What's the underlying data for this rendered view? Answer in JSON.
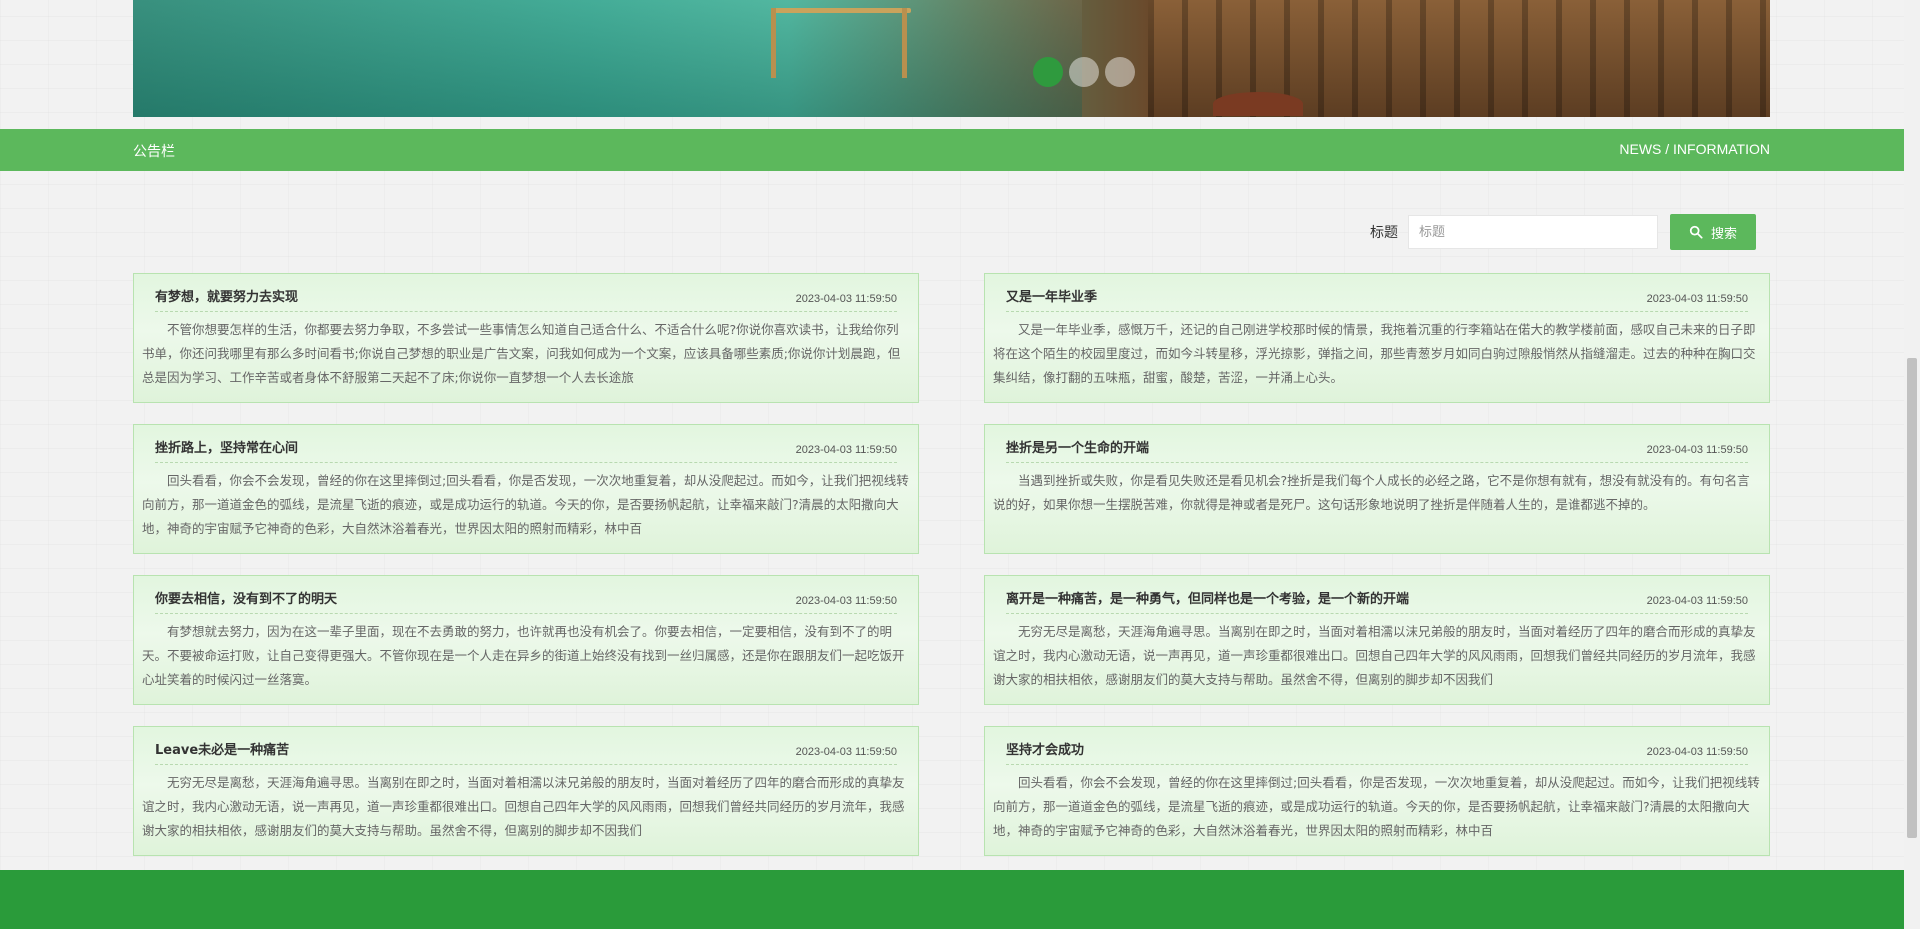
{
  "carousel": {
    "slide_count": 3,
    "active_index": 0,
    "active_color": "#2f9a3e"
  },
  "notice_bar": {
    "title": "公告栏",
    "subtitle": "NEWS / INFORMATION",
    "color": "#5cb85c"
  },
  "search": {
    "label": "标题",
    "placeholder": "标题",
    "value": "",
    "button_label": "搜索",
    "button_icon": "search-icon"
  },
  "notices": [
    {
      "title": "有梦想，就要努力去实现",
      "time": "2023-04-03 11:59:50",
      "content": "不管你想要怎样的生活，你都要去努力争取，不多尝试一些事情怎么知道自己适合什么、不适合什么呢?你说你喜欢读书，让我给你列书单，你还问我哪里有那么多时间看书;你说自己梦想的职业是广告文案，问我如何成为一个文案，应该具备哪些素质;你说你计划晨跑，但总是因为学习、工作辛苦或者身体不舒服第二天起不了床;你说你一直梦想一个人去长途旅"
    },
    {
      "title": "又是一年毕业季",
      "time": "2023-04-03 11:59:50",
      "content": "又是一年毕业季，感慨万千，还记的自己刚进学校那时候的情景，我拖着沉重的行李箱站在偌大的教学楼前面，感叹自己未来的日子即将在这个陌生的校园里度过，而如今斗转星移，浮光掠影，弹指之间，那些青葱岁月如同白驹过隙般悄然从指缝溜走。过去的种种在胸口交集纠结，像打翻的五味瓶，甜蜜，酸楚，苦涩，一并涌上心头。"
    },
    {
      "title": "挫折路上，坚持常在心间",
      "time": "2023-04-03 11:59:50",
      "content": "回头看看，你会不会发现，曾经的你在这里摔倒过;回头看看，你是否发现，一次次地重复着，却从没爬起过。而如今，让我们把视线转向前方，那一道道金色的弧线，是流星飞逝的痕迹，或是成功运行的轨道。今天的你，是否要扬帆起航，让幸福来敲门?清晨的太阳撒向大地，神奇的宇宙赋予它神奇的色彩，大自然沐浴着春光，世界因太阳的照射而精彩，林中百"
    },
    {
      "title": "挫折是另一个生命的开端",
      "time": "2023-04-03 11:59:50",
      "content": "当遇到挫折或失败，你是看见失败还是看见机会?挫折是我们每个人成长的必经之路，它不是你想有就有，想没有就没有的。有句名言说的好，如果你想一生摆脱苦难，你就得是神或者是死尸。这句话形象地说明了挫折是伴随着人生的，是谁都逃不掉的。"
    },
    {
      "title": "你要去相信，没有到不了的明天",
      "time": "2023-04-03 11:59:50",
      "content": "有梦想就去努力，因为在这一辈子里面，现在不去勇敢的努力，也许就再也没有机会了。你要去相信，一定要相信，没有到不了的明天。不要被命运打败，让自己变得更强大。不管你现在是一个人走在异乡的街道上始终没有找到一丝归属感，还是你在跟朋友们一起吃饭开心址笑着的时候闪过一丝落寞。"
    },
    {
      "title": "离开是一种痛苦，是一种勇气，但同样也是一个考验，是一个新的开端",
      "time": "2023-04-03 11:59:50",
      "content": "无穷无尽是离愁，天涯海角遍寻思。当离别在即之时，当面对着相濡以沫兄弟般的朋友时，当面对着经历了四年的磨合而形成的真挚友谊之时，我内心激动无语，说一声再见，道一声珍重都很难出口。回想自己四年大学的风风雨雨，回想我们曾经共同经历的岁月流年，我感谢大家的相扶相依，感谢朋友们的莫大支持与帮助。虽然舍不得，但离别的脚步却不因我们"
    },
    {
      "title": "Leave未必是一种痛苦",
      "time": "2023-04-03 11:59:50",
      "content": "无穷无尽是离愁，天涯海角遍寻思。当离别在即之时，当面对着相濡以沫兄弟般的朋友时，当面对着经历了四年的磨合而形成的真挚友谊之时，我内心激动无语，说一声再见，道一声珍重都很难出口。回想自己四年大学的风风雨雨，回想我们曾经共同经历的岁月流年，我感谢大家的相扶相依，感谢朋友们的莫大支持与帮助。虽然舍不得，但离别的脚步却不因我们"
    },
    {
      "title": "坚持才会成功",
      "time": "2023-04-03 11:59:50",
      "content": "回头看看，你会不会发现，曾经的你在这里摔倒过;回头看看，你是否发现，一次次地重复着，却从没爬起过。而如今，让我们把视线转向前方，那一道道金色的弧线，是流星飞逝的痕迹，或是成功运行的轨道。今天的你，是否要扬帆起航，让幸福来敲门?清晨的太阳撒向大地，神奇的宇宙赋予它神奇的色彩，大自然沐浴着春光，世界因太阳的照射而精彩，林中百"
    }
  ],
  "footer": {
    "color": "#2a9b3a"
  }
}
